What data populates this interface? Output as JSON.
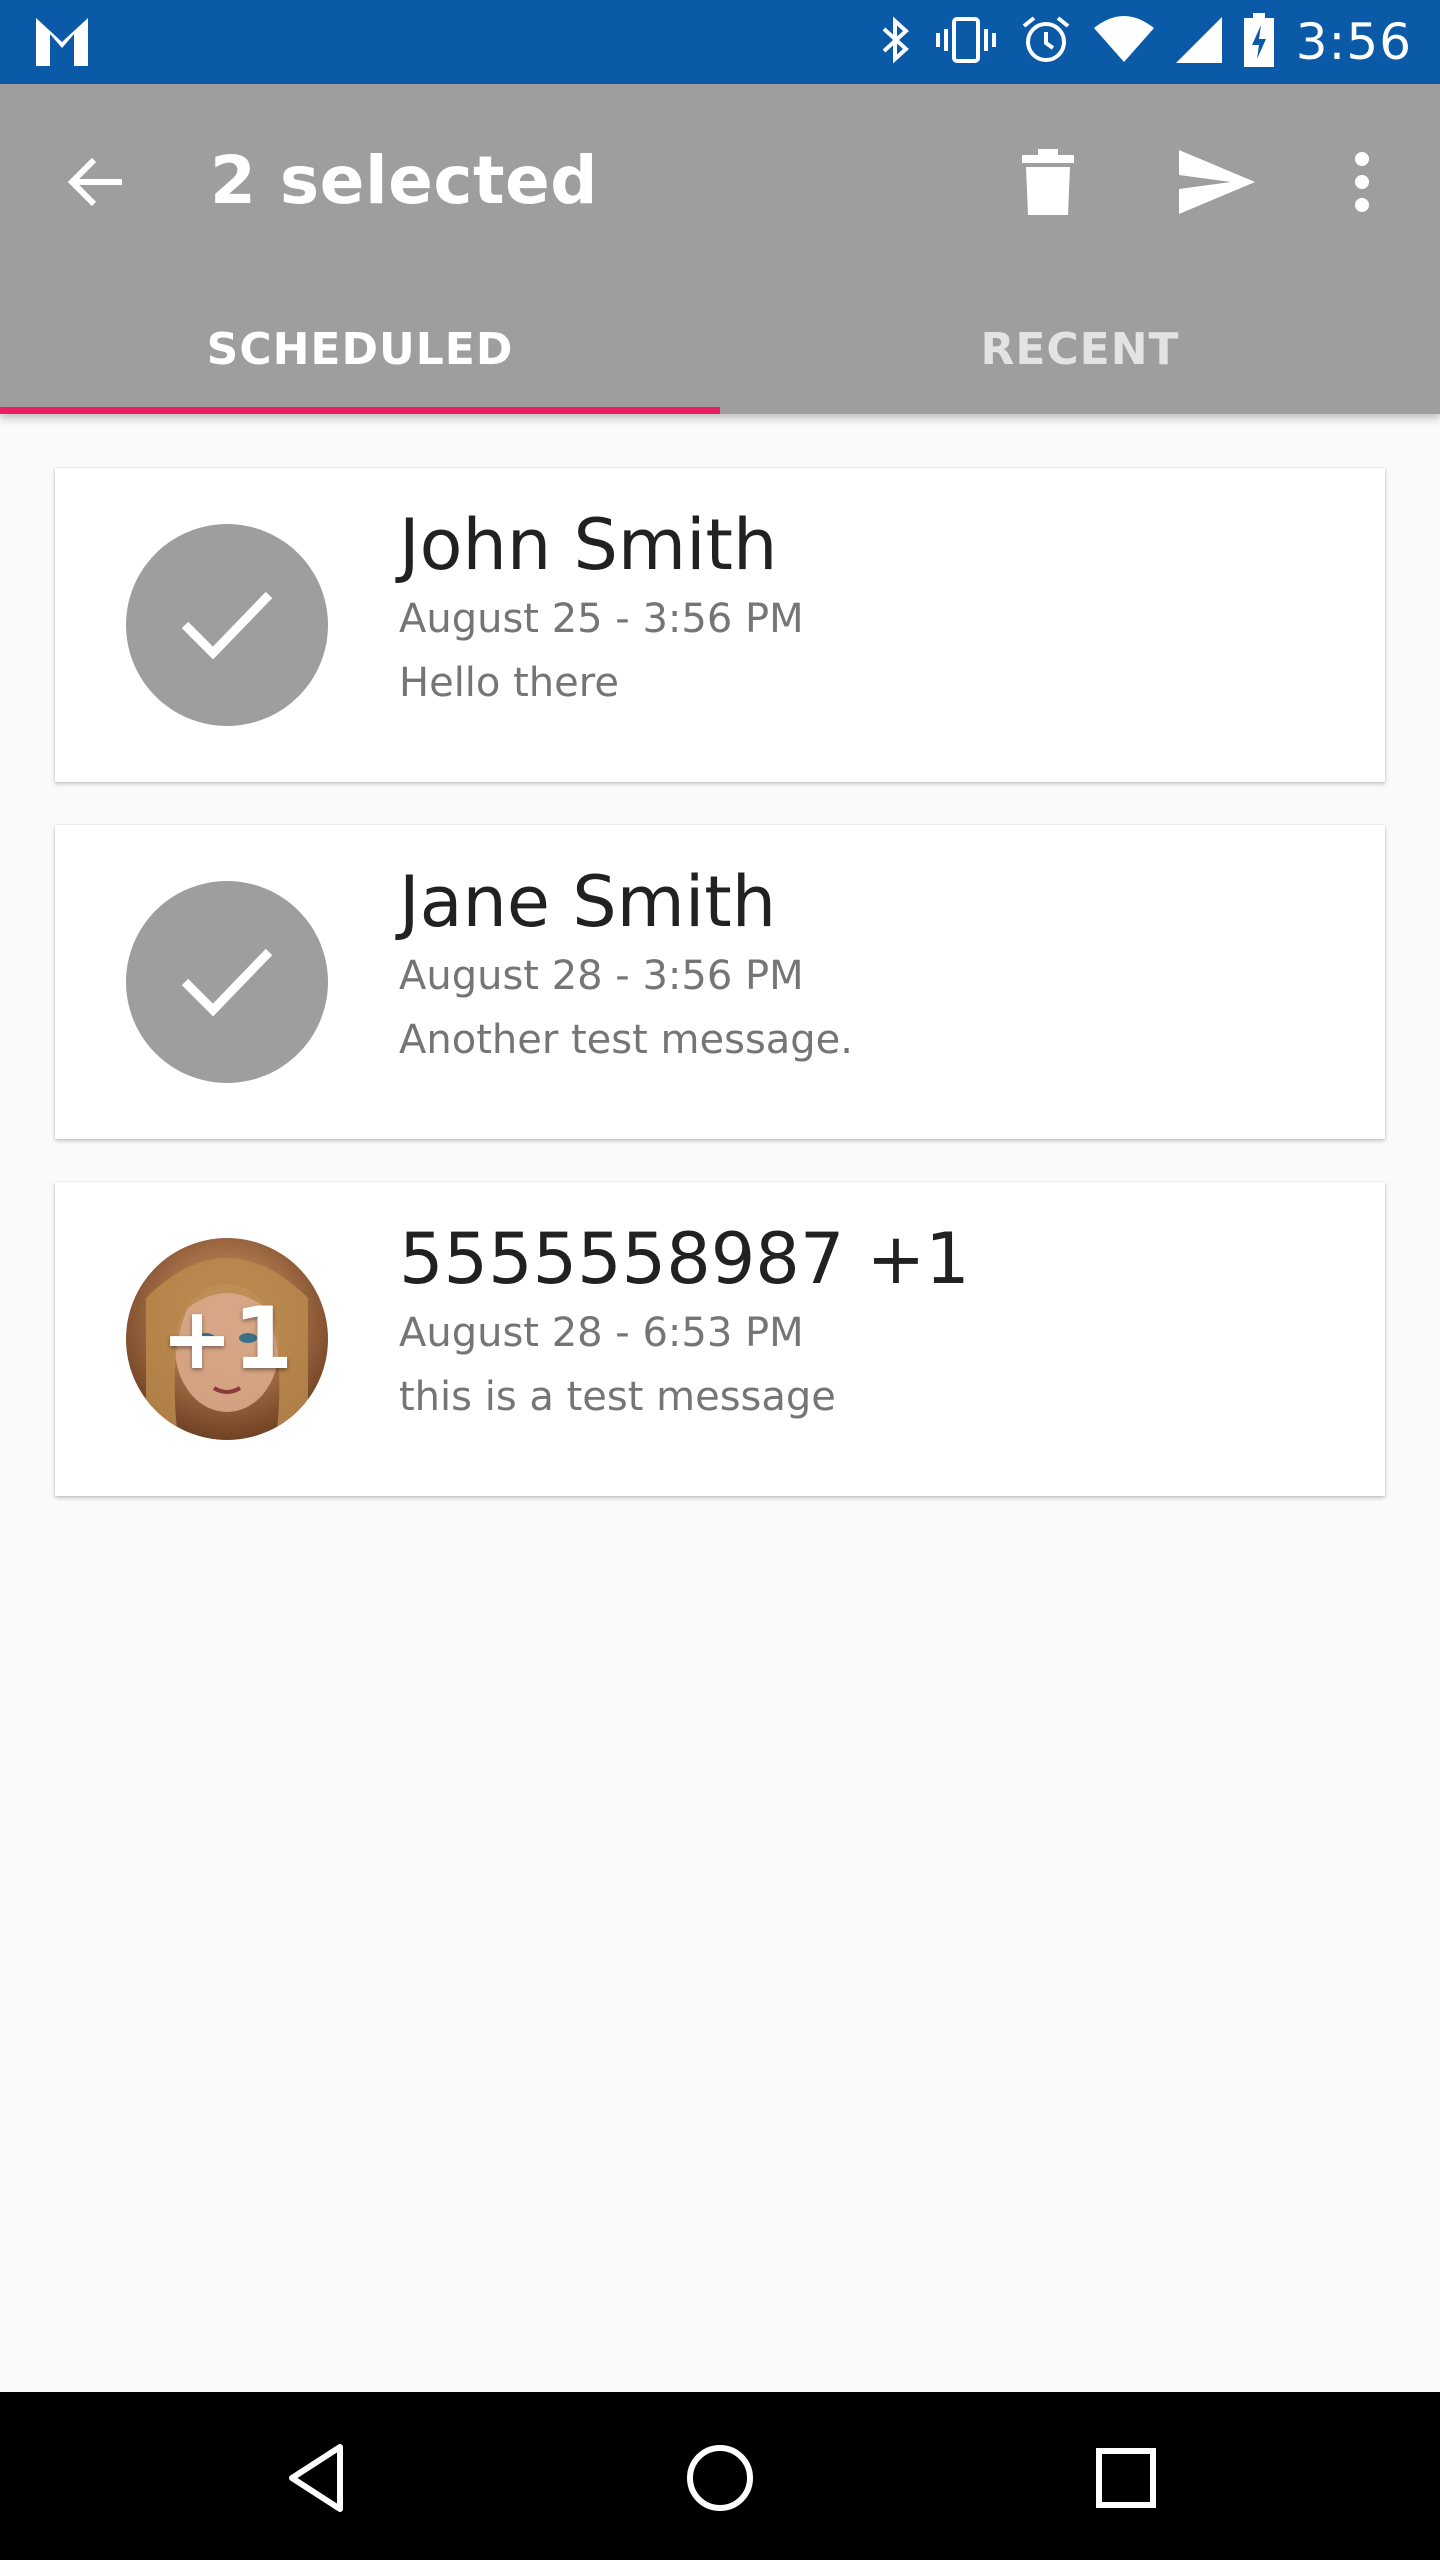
{
  "status_bar": {
    "time": "3:56",
    "icons": [
      "gmail-icon",
      "bluetooth-icon",
      "vibrate-icon",
      "alarm-icon",
      "wifi-icon",
      "signal-icon",
      "battery-charging-icon"
    ]
  },
  "app_bar": {
    "title": "2 selected",
    "back_icon": "arrow-back-icon",
    "actions": [
      "delete-icon",
      "send-icon",
      "more-vert-icon"
    ],
    "color": "#9e9e9e"
  },
  "tabs": [
    {
      "label": "SCHEDULED",
      "active": true
    },
    {
      "label": "RECENT",
      "active": false
    }
  ],
  "accent_color": "#e91e63",
  "messages": [
    {
      "name": "John Smith",
      "date": "August 25 - 3:56 PM",
      "message": "Hello there",
      "selected": true,
      "avatar": "check-icon"
    },
    {
      "name": "Jane Smith",
      "date": "August 28 - 3:56 PM",
      "message": "Another test message.",
      "selected": true,
      "avatar": "check-icon"
    },
    {
      "name": "5555558987 +1",
      "date": "August 28 - 6:53 PM",
      "message": "this is a test message",
      "selected": false,
      "avatar": "photo",
      "avatar_overlay": "+1"
    }
  ],
  "nav_bar": {
    "buttons": [
      "back-triangle-icon",
      "home-circle-icon",
      "recents-square-icon"
    ]
  }
}
